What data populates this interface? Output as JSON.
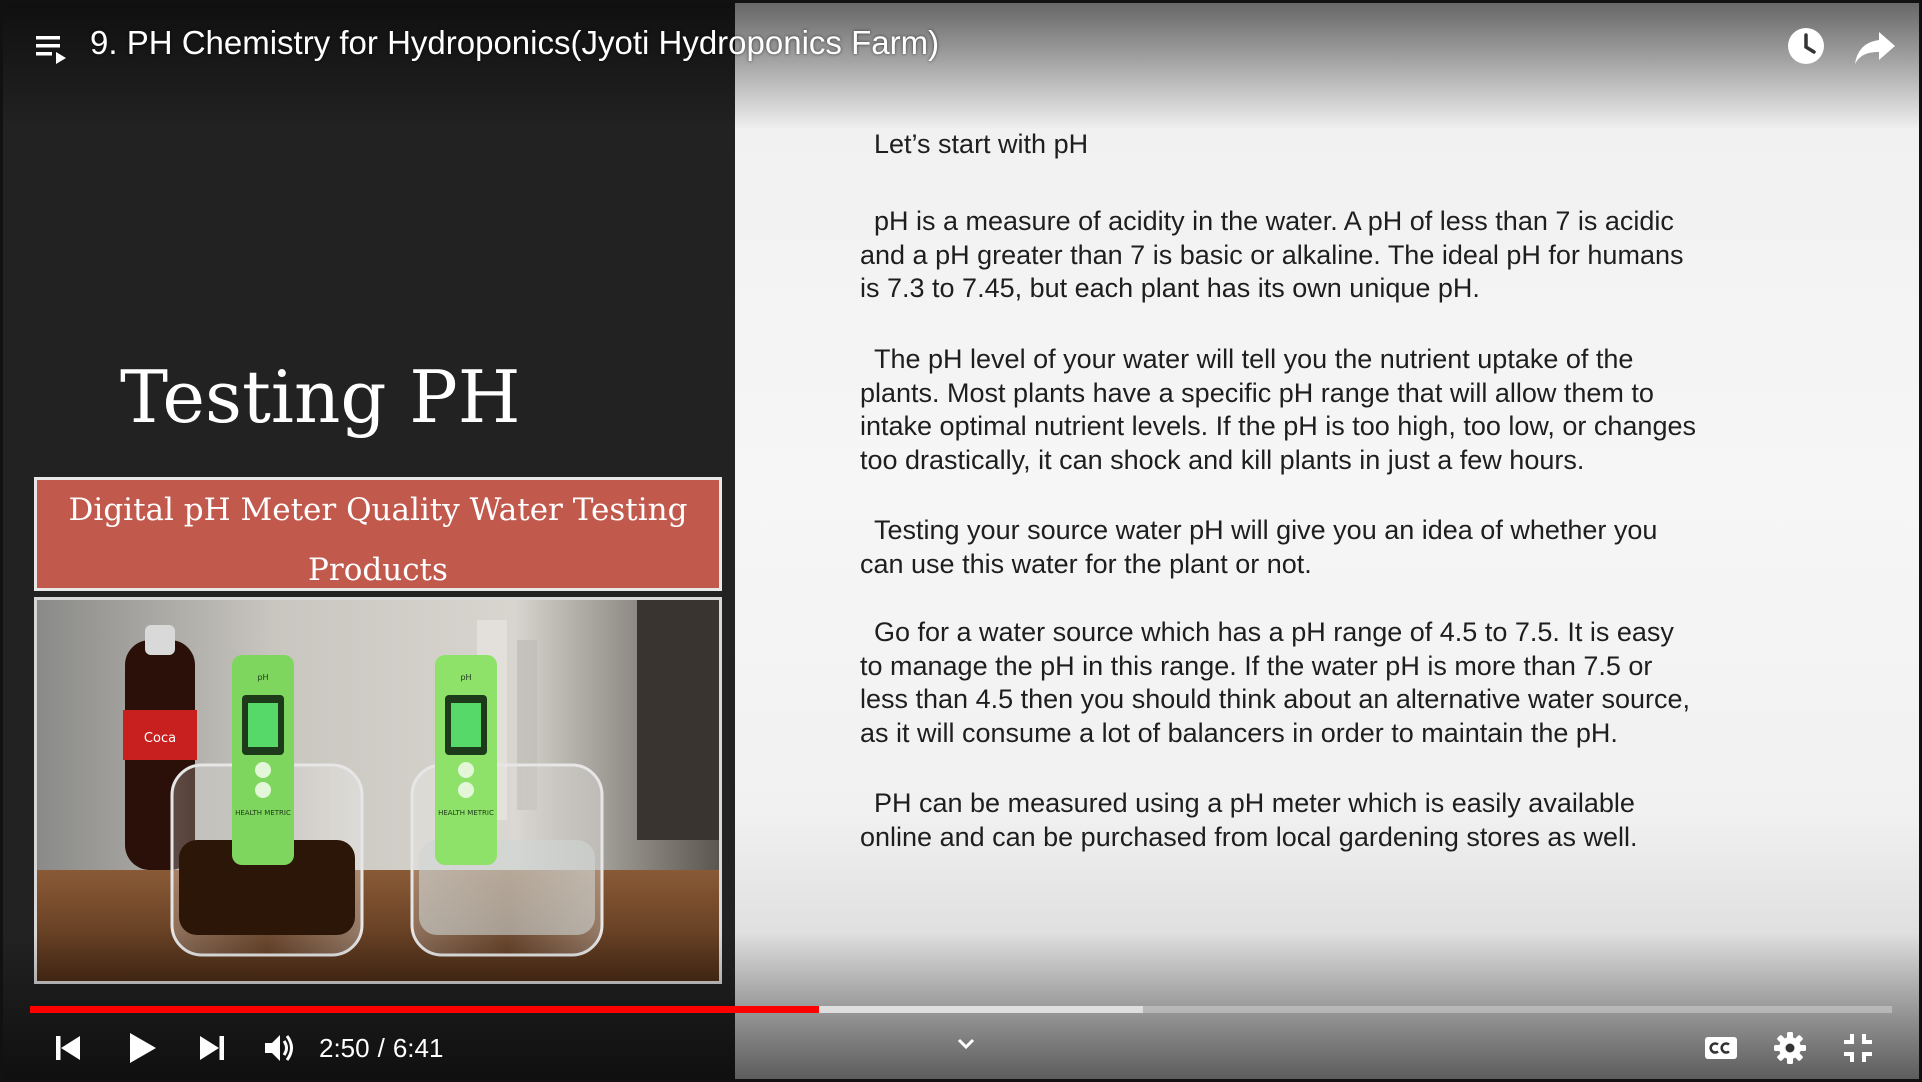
{
  "player": {
    "title": "9. PH Chemistry for Hydroponics(Jyoti Hydroponics Farm)",
    "time_current": "2:50",
    "time_separator": "/",
    "time_total": "6:41",
    "progress_fraction": 0.424,
    "buffered_fraction": 0.598,
    "accent_color": "#ff0000",
    "icons": {
      "playlist": "playlist-icon",
      "watch_later": "clock-icon",
      "share": "share-arrow-icon",
      "previous": "skip-previous-icon",
      "play": "play-icon",
      "next": "skip-next-icon",
      "volume": "volume-icon",
      "more": "chevron-down-icon",
      "captions": "cc-icon",
      "settings": "gear-icon",
      "exit_fullscreen": "exit-fullscreen-icon"
    }
  },
  "slide": {
    "heading": "Testing PH",
    "banner_line1": "Digital pH Meter Quality Water Testing",
    "banner_line2": "Products",
    "banner_color": "#c1594d",
    "photo_meter_label": "pH",
    "photo_brand_label": "HEALTH METRIC",
    "paragraphs": {
      "intro": "Let’s start with pH",
      "p1": [
        "pH is a measure of acidity in the water. A pH of less than 7 is acidic",
        "and a pH greater than 7 is basic or alkaline. The ideal pH for humans",
        "is 7.3 to 7.45, but each plant has its own unique pH."
      ],
      "p2": [
        "The pH level of your water will tell you the nutrient uptake of the",
        "plants. Most plants have a specific pH range that will allow them to",
        "intake optimal nutrient levels. If the pH is too high, too low, or changes",
        "too drastically, it can shock and kill plants in just a few hours."
      ],
      "p3": [
        "Testing your source water pH will give you an idea of whether you",
        "can use this water for the plant or not."
      ],
      "p4": [
        "Go for a water source which has a pH range of 4.5 to 7.5. It is easy",
        "to manage the pH in this range. If the water pH is more than 7.5 or",
        "less than 4.5 then you should think about an alternative water source,",
        "as it will consume a lot of balancers in order to maintain the pH."
      ],
      "p5": [
        "PH can be measured using a pH meter which is easily available",
        "online and can be purchased from local gardening stores as well."
      ]
    }
  }
}
